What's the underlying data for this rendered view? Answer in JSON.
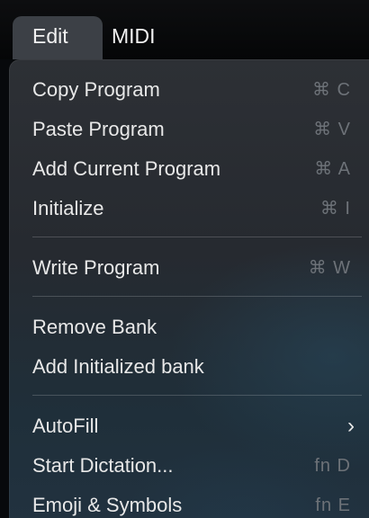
{
  "menubar": {
    "items": [
      {
        "label": "Edit"
      },
      {
        "label": "MIDI"
      }
    ]
  },
  "menu": {
    "groups": [
      {
        "items": [
          {
            "label": "Copy Program",
            "shortcut": "⌘ C"
          },
          {
            "label": "Paste Program",
            "shortcut": "⌘ V"
          },
          {
            "label": "Add Current Program",
            "shortcut": "⌘ A"
          },
          {
            "label": "Initialize",
            "shortcut": "⌘ I"
          }
        ]
      },
      {
        "items": [
          {
            "label": "Write Program",
            "shortcut": "⌘ W"
          }
        ]
      },
      {
        "items": [
          {
            "label": "Remove Bank"
          },
          {
            "label": "Add Initialized bank"
          }
        ]
      },
      {
        "items": [
          {
            "label": "AutoFill",
            "submenu_indicator": "›"
          },
          {
            "label": "Start Dictation...",
            "shortcut": "fn D"
          },
          {
            "label": "Emoji & Symbols",
            "shortcut": "fn E"
          }
        ]
      }
    ]
  },
  "colors": {
    "menu_text": "#e8e8e8",
    "shortcut_text": "#6d7278",
    "menu_background": "#2a2e33",
    "active_menubar_item": "#3c4046"
  },
  "icons": {
    "command_symbol": "⌘",
    "submenu_chevron": "chevron-right-icon"
  }
}
